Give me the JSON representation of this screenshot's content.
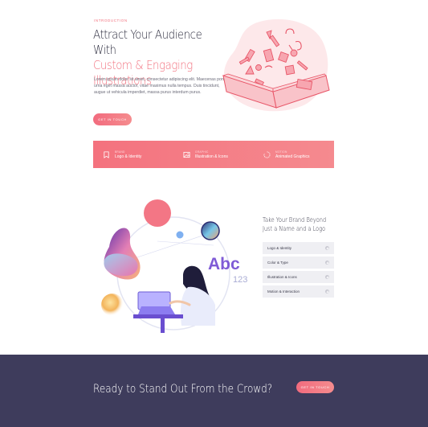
{
  "hero": {
    "eyebrow": "INTRODUCTION",
    "title_line1": "Attract Your Audience With",
    "title_line2": "Custom & Engaging",
    "title_line3": "Illustrations",
    "body": "Lorem ipsum dolor sit amet, consectetur adipiscing elit. Maecenas porta urna eget massa auctor, vitae maximus nulla tempus. Duis tincidunt, augue ut vehicula imperdiet, massa purus interdum purus.",
    "button_label": "GET IN TOUCH"
  },
  "features": [
    {
      "overline": "BRAND",
      "label": "Logo & Identity",
      "icon": "bookmark-icon"
    },
    {
      "overline": "GRAPHIC",
      "label": "Illustration & Icons",
      "icon": "image-icon"
    },
    {
      "overline": "MOTION",
      "label": "Animated Graphics",
      "icon": "loader-icon"
    }
  ],
  "scene": {
    "abc_text": "Abc",
    "num_text": "123"
  },
  "services": {
    "title": "Take Your Brand Beyond Just a Name and a Logo",
    "items": [
      {
        "label": "Logo & Identity"
      },
      {
        "label": "Color & Type"
      },
      {
        "label": "Illustration & Icons"
      },
      {
        "label": "Motion & Interaction"
      }
    ]
  },
  "cta": {
    "text": "Ready to Stand Out From the Crowd?",
    "button_label": "GET IN TOUCH"
  },
  "colors": {
    "accent": "#f2727f",
    "dark": "#3e3c5c",
    "purple": "#7f5bd6"
  }
}
